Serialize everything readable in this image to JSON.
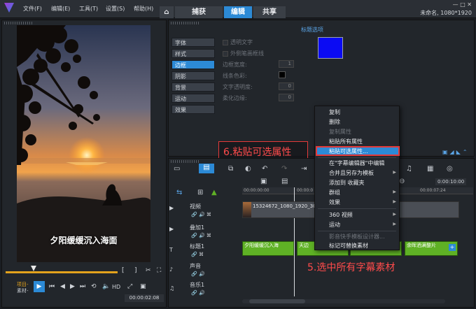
{
  "menu": [
    "文件(F)",
    "编辑(E)",
    "工具(T)",
    "设置(S)",
    "帮助(H)"
  ],
  "tabs": [
    "捕获",
    "编辑",
    "共享"
  ],
  "project_info": "未命名, 1080*1920",
  "preview": {
    "subtitle": "夕阳缓缓沉入海面",
    "timecode": "00:00:02:08",
    "mode_project": "项目-",
    "mode_clip": "素材-",
    "hd_label": "HD"
  },
  "options": {
    "title": "标题选项",
    "tabs": [
      "字体",
      "样式",
      "边框",
      "阴影",
      "背景",
      "运动",
      "效果"
    ],
    "settings": {
      "transparent_text": "透明文字",
      "outer_border": "外侧笔画框线",
      "border_width": "边框宽度:",
      "border_width_value": "1",
      "line_color": "线条色彩:",
      "text_transparency": "文字透明度:",
      "text_transparency_value": "0",
      "soften_edge": "柔化边缘:",
      "soften_edge_value": "0"
    },
    "color_hex": "#0b0bf3"
  },
  "context_menu": {
    "items": [
      "复制",
      "删除",
      "复制属性",
      "粘贴所有属性",
      "粘贴可选属性...",
      "在\"字幕编辑器\"中编辑",
      "合并且另存为模板",
      "添加到 收藏夹",
      "群组",
      "效果",
      "360 视频",
      "运动",
      "影音快手模板设计器...",
      "标记可替换素材"
    ]
  },
  "annotations": {
    "step6": "6.粘贴可选属性",
    "step5": "5.选中所有字幕素材"
  },
  "timeline": {
    "ruler": [
      "00:00:00:00",
      "00:00:0",
      "00:00:07:24"
    ],
    "timecode": "0:00:10:00",
    "tracks": [
      "视频",
      "叠加1",
      "标题1",
      "声音",
      "音乐1"
    ],
    "video_clip": "15324672_1080_1920_30fps",
    "title_clips": [
      "夕阳缓缓沉入海",
      "天边",
      "",
      "余晖洒满整片"
    ]
  }
}
